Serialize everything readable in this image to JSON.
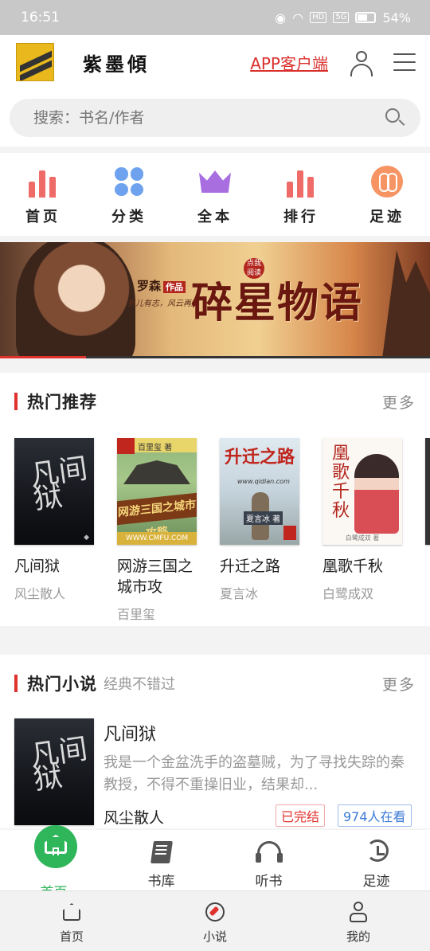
{
  "status_bar": {
    "time": "16:51",
    "battery": "54%",
    "hd": "HD",
    "signal_gen": "5G"
  },
  "header": {
    "logo_text": "紫墨傾",
    "app_link": "APP客户端"
  },
  "search": {
    "placeholder": "搜索：书名/作者"
  },
  "quick_nav": [
    {
      "label": "首页",
      "icon": "bar-chart-icon",
      "color": "#ef6b67"
    },
    {
      "label": "分类",
      "icon": "grid-dots-icon",
      "color": "#6ea2ef"
    },
    {
      "label": "全本",
      "icon": "crown-icon",
      "color": "#a86ee0"
    },
    {
      "label": "排行",
      "icon": "bar-chart-icon",
      "color": "#ef6b67"
    },
    {
      "label": "足迹",
      "icon": "footprints-icon",
      "color": "#f79464"
    }
  ],
  "banner": {
    "author": "罗森",
    "author_tag": "作品",
    "slogan": "男儿有志，风云再起",
    "title": "碎星物语",
    "tag": "点我阅读"
  },
  "hot_recommend": {
    "title": "热门推荐",
    "more": "更多",
    "books": [
      {
        "title": "凡间狱",
        "author": "风尘散人",
        "cover_text": "凡间狱"
      },
      {
        "title": "网游三国之城市攻",
        "author": "百里玺",
        "cover_text": "网游三国之城市攻略",
        "cover_author": "百里玺 著",
        "cover_url": "WWW.CMFU.COM"
      },
      {
        "title": "升迁之路",
        "author": "夏言冰",
        "cover_text": "升迁之路",
        "cover_author": "夏言冰 著",
        "cover_url": "www.qidian.com"
      },
      {
        "title": "凰歌千秋",
        "author": "白鹭成双",
        "cover_text": "凰歌千秋",
        "cover_footer": "白鹭成双 著"
      }
    ]
  },
  "hot_novels": {
    "title": "热门小说",
    "subtitle": "经典不错过",
    "more": "更多",
    "items": [
      {
        "title": "凡间狱",
        "desc": "我是一个金盆洗手的盗墓贼，为了寻找失踪的秦教授，不得不重操旧业，结果却...",
        "author": "风尘散人",
        "status": "已完结",
        "reads": "974人在看"
      }
    ]
  },
  "tab_bar": [
    {
      "label": "首页",
      "active": true
    },
    {
      "label": "书库",
      "active": false
    },
    {
      "label": "听书",
      "active": false
    },
    {
      "label": "足迹",
      "active": false
    }
  ],
  "system_nav": [
    {
      "label": "首页"
    },
    {
      "label": "小说"
    },
    {
      "label": "我的"
    }
  ]
}
